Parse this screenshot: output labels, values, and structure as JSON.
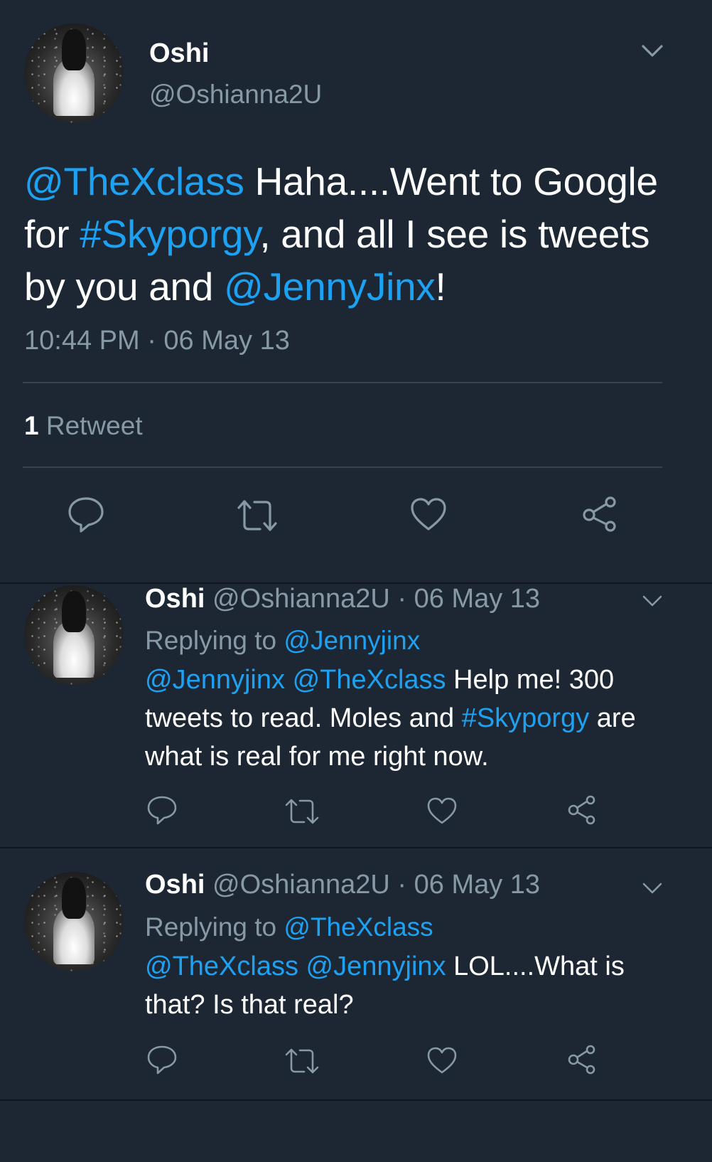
{
  "main_tweet": {
    "name": "Oshi",
    "handle": "@Oshianna2U",
    "text_parts": [
      {
        "text": "@TheXclass",
        "type": "mention"
      },
      {
        "text": " Haha....Went to Google for ",
        "type": "text"
      },
      {
        "text": "#Skyporgy",
        "type": "hashtag"
      },
      {
        "text": ", and all I see is tweets by you and ",
        "type": "text"
      },
      {
        "text": "@JennyJinx",
        "type": "mention"
      },
      {
        "text": "!",
        "type": "text"
      }
    ],
    "timestamp": "10:44 PM · 06 May 13",
    "retweet_count": "1",
    "retweet_label": "Retweet"
  },
  "replies": [
    {
      "name": "Oshi",
      "handle_date": "@Oshianna2U · 06 May 13",
      "replying_label": "Replying to",
      "replying_to": "@Jennyjinx",
      "text_parts": [
        {
          "text": "@Jennyjinx",
          "type": "mention"
        },
        {
          "text": " ",
          "type": "text"
        },
        {
          "text": "@TheXclass",
          "type": "mention"
        },
        {
          "text": " Help me! 300 tweets to read. Moles and ",
          "type": "text"
        },
        {
          "text": "#Skyporgy",
          "type": "hashtag"
        },
        {
          "text": " are what is real for me right now.",
          "type": "text"
        }
      ]
    },
    {
      "name": "Oshi",
      "handle_date": "@Oshianna2U · 06 May 13",
      "replying_label": "Replying to",
      "replying_to": "@TheXclass",
      "text_parts": [
        {
          "text": "@TheXclass",
          "type": "mention"
        },
        {
          "text": " ",
          "type": "text"
        },
        {
          "text": "@Jennyjinx",
          "type": "mention"
        },
        {
          "text": " LOL....What is that? Is that real?",
          "type": "text"
        }
      ]
    }
  ],
  "icons": {
    "reply": "reply-icon",
    "retweet": "retweet-icon",
    "like": "heart-icon",
    "share": "share-icon",
    "menu": "chevron-down-icon"
  },
  "colors": {
    "background": "#1c2733",
    "link": "#1da1f2",
    "muted": "#8899a6",
    "divider": "#38444d"
  }
}
